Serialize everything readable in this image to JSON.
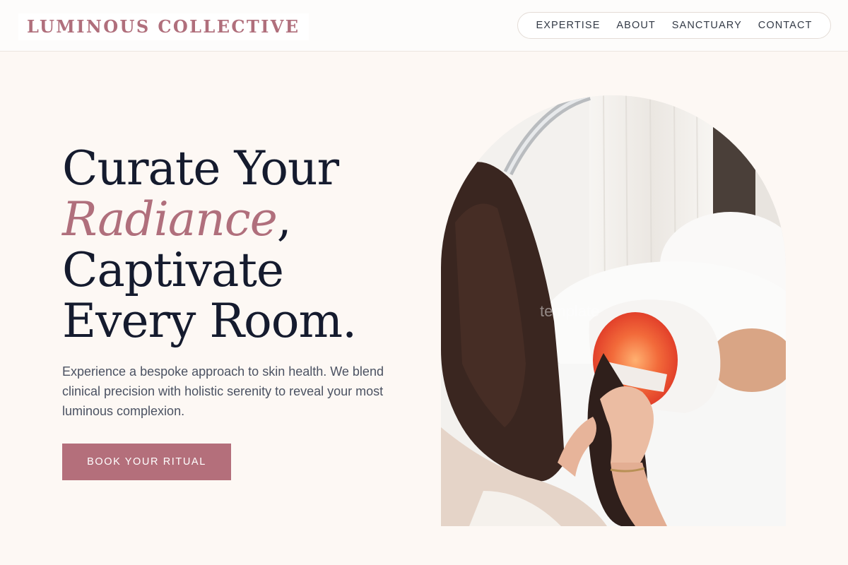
{
  "brand": {
    "name": "LUMINOUS COLLECTIVE"
  },
  "nav": {
    "items": [
      {
        "label": "EXPERTISE"
      },
      {
        "label": "ABOUT"
      },
      {
        "label": "SANCTUARY"
      },
      {
        "label": "CONTACT"
      }
    ]
  },
  "hero": {
    "headline_line1": "Curate Your",
    "headline_accent": "Radiance",
    "headline_comma": ",",
    "headline_line3": "Captivate",
    "headline_line4": "Every Room.",
    "description": "Experience a bespoke approach to skin health. We blend clinical precision with holistic serenity to reveal your most luminous complexion.",
    "cta_label": "BOOK YOUR RITUAL",
    "image_watermark": "template"
  },
  "colors": {
    "accent": "#b06f7c",
    "button": "#b46f7b",
    "background": "#fdf8f4",
    "heading": "#151b2e"
  }
}
